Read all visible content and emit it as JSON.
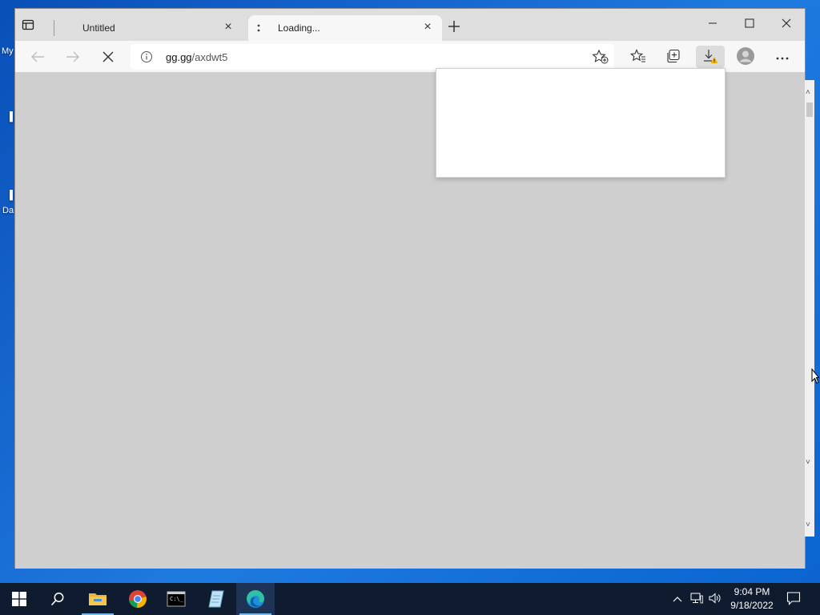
{
  "desktop": {
    "labels": [
      "My",
      "Da"
    ]
  },
  "browser": {
    "tabs": [
      {
        "label": "Untitled",
        "state": "inactive"
      },
      {
        "label": "Loading...",
        "state": "active"
      }
    ],
    "address": {
      "host": "gg.gg",
      "path": "/axdwt5"
    },
    "window_controls": [
      "minimize",
      "maximize",
      "close"
    ]
  },
  "icons": {
    "tab_actions": "tab-actions-icon",
    "new_tab": "plus-icon",
    "back": "back-arrow-icon",
    "forward": "forward-arrow-icon",
    "stop": "stop-loading-icon",
    "site_info": "info-icon",
    "add_favorite": "add-favorite-icon",
    "favorites": "favorites-icon",
    "collections": "collections-icon",
    "downloads": "downloads-warning-icon",
    "profile": "profile-icon",
    "menu": "more-icon"
  },
  "taskbar": {
    "apps": [
      "start",
      "search",
      "file-explorer",
      "chrome",
      "terminal",
      "notepad",
      "edge"
    ],
    "active_app": "edge",
    "time": "9:04 PM",
    "date": "9/18/2022"
  },
  "colors": {
    "accent": "#0a5fc9",
    "taskbar": "#0f1b2e",
    "content_bg": "#cfcfcf"
  }
}
